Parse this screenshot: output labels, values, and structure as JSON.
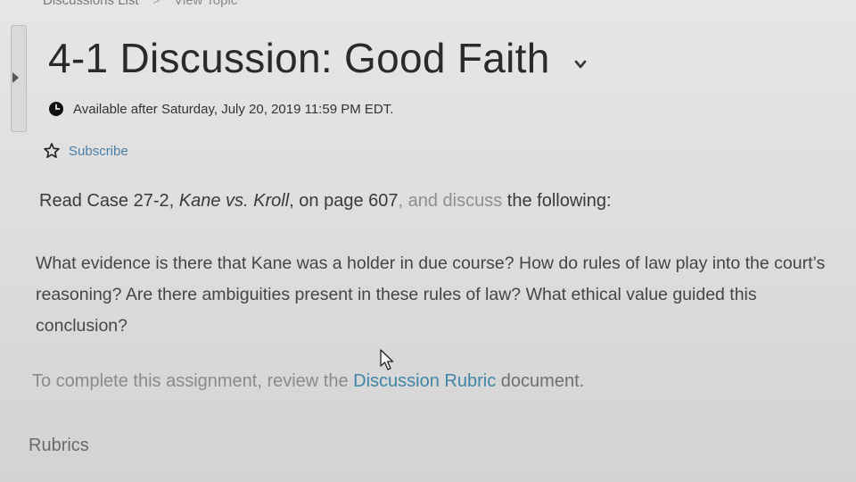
{
  "breadcrumb": {
    "items": [
      "Discussions List",
      "View Topic"
    ],
    "separator": ">"
  },
  "topic": {
    "title": "4-1 Discussion: Good Faith",
    "availability": "Available after Saturday, July 20, 2019 11:59 PM EDT.",
    "subscribe_label": "Subscribe"
  },
  "body": {
    "intro_prefix": "Read Case 27-2, ",
    "intro_case": "Kane vs. Kroll",
    "intro_mid": ", on page 607",
    "intro_fade": ", and discuss",
    "intro_end": " the following:",
    "questions": "What evidence is there that Kane was a holder in due course? How do rules of law play into the court’s reasoning? Are there ambiguities present in these rules of law? What ethical value guided this conclusion?",
    "complete_prefix": "To complete this assignment, review the ",
    "rubric_link": "Discussion Rubric",
    "complete_suffix": " document."
  },
  "rubrics": {
    "heading": "Rubrics"
  },
  "icons": {
    "clock": "clock-icon",
    "star": "star-outline-icon",
    "chevron": "chevron-down-icon",
    "cursor": "mouse-pointer-icon",
    "rail": "collapse-panel-arrow-icon"
  },
  "colors": {
    "link": "#4a7fa8",
    "rubric_link": "#3f86a6",
    "title": "#2a2a2a",
    "background": "#dedede"
  }
}
